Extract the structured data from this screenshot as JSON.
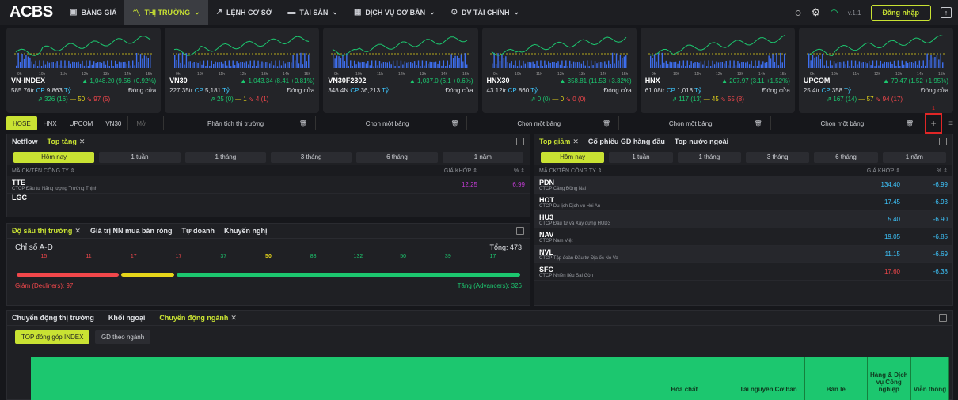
{
  "nav": {
    "logo": "ACBS",
    "items": [
      {
        "label": "BẢNG GIÁ",
        "icon": "tv-icon"
      },
      {
        "label": "THỊ TRƯỜNG",
        "icon": "chart-line-icon"
      },
      {
        "label": "LỆNH CƠ SỞ",
        "icon": "trend-icon"
      },
      {
        "label": "TÀI SẢN",
        "icon": "folder-icon"
      },
      {
        "label": "DỊCH VỤ CƠ BẢN",
        "icon": "grid-icon"
      },
      {
        "label": "DV TÀI CHÍNH",
        "icon": "money-icon"
      }
    ],
    "version": "v.1.1",
    "login": "Đăng nhập"
  },
  "cards": [
    {
      "name": "VN-INDEX",
      "value": "1,048.20 (9.56 +0.92%)",
      "vol": "585.76tr",
      "vunit": "CP",
      "val": "9,863",
      "vvunit": "Tỷ",
      "status": "Đóng cửa",
      "adv": "326 (16)",
      "ref": "50",
      "dec": "97 (5)"
    },
    {
      "name": "VN30",
      "value": "1,043.34 (8.41 +0.81%)",
      "vol": "227.35tr",
      "vunit": "CP",
      "val": "5,181",
      "vvunit": "Tỷ",
      "status": "Đóng cửa",
      "adv": "25 (0)",
      "ref": "1",
      "dec": "4 (1)"
    },
    {
      "name": "VN30F2302",
      "value": "1,037.0 (6.1 +0.6%)",
      "vol": "348.4N",
      "vunit": "CP",
      "val": "36,213",
      "vvunit": "Tỷ",
      "status": "Đóng cửa",
      "adv": "",
      "ref": "",
      "dec": ""
    },
    {
      "name": "HNX30",
      "value": "358.81 (11.53 +3.32%)",
      "vol": "43.12tr",
      "vunit": "CP",
      "val": "860",
      "vvunit": "Tỷ",
      "status": "Đóng cửa",
      "adv": "0 (0)",
      "ref": "0",
      "dec": "0 (0)"
    },
    {
      "name": "HNX",
      "value": "207.97 (3.11 +1.52%)",
      "vol": "61.08tr",
      "vunit": "CP",
      "val": "1,018",
      "vvunit": "Tỷ",
      "status": "Đóng cửa",
      "adv": "117 (13)",
      "ref": "45",
      "dec": "55 (8)"
    },
    {
      "name": "UPCOM",
      "value": "79.47 (1.52 +1.95%)",
      "vol": "25.4tr",
      "vunit": "CP",
      "val": "358",
      "vvunit": "Tỷ",
      "status": "Đóng cửa",
      "adv": "167 (14)",
      "ref": "57",
      "dec": "94 (17)"
    }
  ],
  "times": [
    "9h",
    "10h",
    "11h",
    "12h",
    "13h",
    "14h",
    "15h"
  ],
  "exchanges": [
    "HOSE",
    "HNX",
    "UPCOM",
    "VN30"
  ],
  "layouts": [
    "Mở",
    "Phân tích thị trường",
    "Chọn một bảng",
    "Chọn một bảng",
    "Chọn một bảng",
    "Chọn một bảng",
    "Chọn một bảng"
  ],
  "badge": "1",
  "left_top": {
    "tabs": [
      "Netflow",
      "Top tăng"
    ],
    "periods": [
      "Hôm nay",
      "1 tuần",
      "1 tháng",
      "3 tháng",
      "6 tháng",
      "1 năm"
    ],
    "col1": "MÃ CK/TÊN CÔNG TY ⇕",
    "col2": "GIÁ KHỚP ⇕",
    "col3": "% ⇕",
    "rows": [
      {
        "sym": "TTE",
        "co": "CTCP Đầu tư Năng lượng Trường Thịnh",
        "price": "12.25",
        "pct": "6.99"
      },
      {
        "sym": "LGC",
        "co": "",
        "price": "",
        "pct": ""
      }
    ]
  },
  "depth": {
    "tabs": [
      "Độ sâu thị trường",
      "Giá trị NN mua bán ròng",
      "Tự doanh",
      "Khuyến nghị"
    ],
    "title": "Chỉ số A-D",
    "total": "Tổng: 473",
    "buckets": [
      "15",
      "11",
      "17",
      "17",
      "37",
      "50",
      "88",
      "132",
      "50",
      "39",
      "17"
    ],
    "bar_fractions": {
      "decliners": 0.205,
      "ref": 0.106,
      "advancers": 0.689
    },
    "decl": "Giảm (Decliners): 97",
    "adv": "Tăng (Advancers): 326"
  },
  "right": {
    "tabs": [
      "Top giảm",
      "Cổ phiếu GD hàng đầu",
      "Top nước ngoài"
    ],
    "periods": [
      "Hôm nay",
      "1 tuần",
      "1 tháng",
      "3 tháng",
      "6 tháng",
      "1 năm"
    ],
    "col1": "MÃ CK/TÊN CÔNG TY ⇕",
    "col2": "GIÁ KHỚP ⇕",
    "col3": "% ⇕",
    "rows": [
      {
        "sym": "PDN",
        "co": "CTCP Cảng Đồng Nai",
        "price": "134.40",
        "pct": "-6.99"
      },
      {
        "sym": "HOT",
        "co": "CTCP Du lịch Dịch vụ Hội An",
        "price": "17.45",
        "pct": "-6.93"
      },
      {
        "sym": "HU3",
        "co": "CTCP Đầu tư và Xây dựng HUD3",
        "price": "5.40",
        "pct": "-6.90"
      },
      {
        "sym": "NAV",
        "co": "CTCP Nam Việt",
        "price": "19.05",
        "pct": "-6.85"
      },
      {
        "sym": "NVL",
        "co": "CTCP Tập đoàn Đầu tư Địa ốc No Va",
        "price": "11.15",
        "pct": "-6.69"
      },
      {
        "sym": "SFC",
        "co": "CTCP Nhiên liệu Sài Gòn",
        "price": "17.60",
        "pct": "-6.38"
      }
    ]
  },
  "bottom": {
    "tabs": [
      "Chuyển động thị trường",
      "Khối ngoại",
      "Chuyển động ngành"
    ],
    "subtabs": [
      "TOP đóng góp INDEX",
      "GD theo ngành"
    ],
    "sectors": [
      "",
      "",
      "",
      "",
      "Hóa chất",
      "Tài nguyên Cơ bản",
      "Bán lẻ",
      "Hàng & Dịch vụ Công nghiệp",
      "Viễn thông"
    ]
  },
  "colors": {
    "accent": "#c9e233",
    "up": "#1cc76f",
    "down": "#f2474b",
    "ref": "#e6d51a",
    "ceiling": "#c23cd4"
  }
}
